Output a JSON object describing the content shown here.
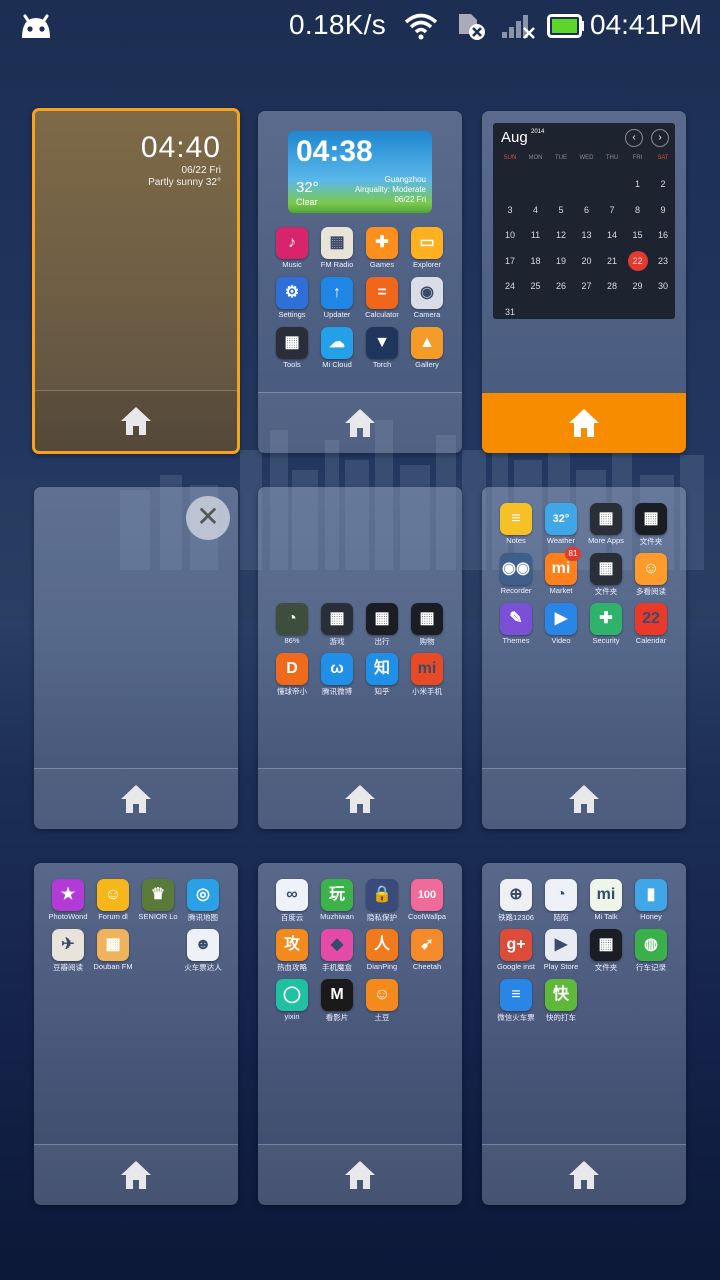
{
  "status_bar": {
    "speed": "0.18K/s",
    "time": "04:41PM",
    "icons": [
      "android-icon",
      "wifi-icon",
      "sim-off-icon",
      "signal-icon",
      "battery-icon"
    ]
  },
  "screens": [
    {
      "id": "screen-1",
      "widget": {
        "type": "clock",
        "time": "04:40",
        "date": "06/22 Fri",
        "weather": "Partly sunny  32°"
      }
    },
    {
      "id": "screen-2",
      "widget": {
        "type": "weather",
        "time": "04:38",
        "temp": "32°",
        "condition": "Clear",
        "city": "Guangzhou",
        "air": "Airquality: Moderate",
        "date": "06/22 Fri"
      },
      "apps": [
        {
          "label": "Music",
          "color": "#d8246a",
          "glyph": "♪"
        },
        {
          "label": "FM Radio",
          "color": "#e9e4d8",
          "glyph": "▦"
        },
        {
          "label": "Games",
          "color": "#ff8f1c",
          "glyph": "✚"
        },
        {
          "label": "Explorer",
          "color": "#ffb020",
          "glyph": "▭"
        },
        {
          "label": "Settings",
          "color": "#2e6fd8",
          "glyph": "⚙"
        },
        {
          "label": "Updater",
          "color": "#1f86e6",
          "glyph": "↑"
        },
        {
          "label": "Calculator",
          "color": "#f0661a",
          "glyph": "="
        },
        {
          "label": "Camera",
          "color": "#d9dde6",
          "glyph": "◉"
        },
        {
          "label": "Tools",
          "color": "#2a2e38",
          "glyph": "▦"
        },
        {
          "label": "Mi Cloud",
          "color": "#23a0e8",
          "glyph": "☁"
        },
        {
          "label": "Torch",
          "color": "#20355c",
          "glyph": "▼"
        },
        {
          "label": "Gallery",
          "color": "#f59b2a",
          "glyph": "▲"
        }
      ]
    },
    {
      "id": "screen-3",
      "widget": {
        "type": "calendar",
        "month": "Aug",
        "year": "2014",
        "weekdays": [
          "SUN",
          "MON",
          "TUE",
          "WED",
          "THU",
          "FRI",
          "SAT"
        ],
        "weeks": [
          [
            "",
            "",
            "",
            "",
            "",
            "1",
            "2"
          ],
          [
            "3",
            "4",
            "5",
            "6",
            "7",
            "8",
            "9"
          ],
          [
            "10",
            "11",
            "12",
            "13",
            "14",
            "15",
            "16"
          ],
          [
            "17",
            "18",
            "19",
            "20",
            "21",
            "22",
            "23"
          ],
          [
            "24",
            "25",
            "26",
            "27",
            "28",
            "29",
            "30"
          ],
          [
            "31",
            "",
            "",
            "",
            "",
            "",
            ""
          ]
        ],
        "today": "22"
      }
    },
    {
      "id": "screen-4",
      "apps": []
    },
    {
      "id": "screen-5",
      "apps": [
        {
          "label": "86%",
          "color": "#3d4e3c",
          "glyph": "◔"
        },
        {
          "label": "游戏",
          "color": "#2a2e38",
          "glyph": "▦"
        },
        {
          "label": "出行",
          "color": "#1a1d24",
          "glyph": "▦"
        },
        {
          "label": "购物",
          "color": "#1a1d24",
          "glyph": "▦"
        },
        {
          "label": "懂球帝小",
          "color": "#f06a1c",
          "glyph": "D"
        },
        {
          "label": "腾讯微博",
          "color": "#1f8fe8",
          "glyph": "ω"
        },
        {
          "label": "知乎",
          "color": "#1f8fe8",
          "glyph": "知"
        },
        {
          "label": "小米手机",
          "color": "#e74a25",
          "glyph": "mi"
        }
      ]
    },
    {
      "id": "screen-6",
      "apps": [
        {
          "label": "Notes",
          "color": "#f5c126",
          "glyph": "≡"
        },
        {
          "label": "Weather",
          "color": "#3fa6e8",
          "glyph": "32°"
        },
        {
          "label": "More Apps",
          "color": "#2a2e38",
          "glyph": "▦"
        },
        {
          "label": "文件夹",
          "color": "#1a1d24",
          "glyph": "▦"
        },
        {
          "label": "Recorder",
          "color": "#3e5e8c",
          "glyph": "◉◉"
        },
        {
          "label": "Market",
          "color": "#ff7f1a",
          "glyph": "mi"
        },
        {
          "label": "文件夹",
          "color": "#2a2e38",
          "glyph": "▦"
        },
        {
          "label": "多看阅读",
          "color": "#ff9b2a",
          "glyph": "☺"
        },
        {
          "label": "Themes",
          "color": "#7b4fd6",
          "glyph": "✎"
        },
        {
          "label": "Video",
          "color": "#2a86e6",
          "glyph": "▶"
        },
        {
          "label": "Security",
          "color": "#2fb36a",
          "glyph": "✚"
        },
        {
          "label": "Calendar",
          "color": "#e8392b",
          "glyph": "22"
        }
      ],
      "badge": "81"
    },
    {
      "id": "screen-7",
      "apps": [
        {
          "label": "PhotoWond",
          "color": "#b43ad8",
          "glyph": "★"
        },
        {
          "label": "Forum dl",
          "color": "#f5b71a",
          "glyph": "☺"
        },
        {
          "label": "SENIOR Lo",
          "color": "#5a7a3a",
          "glyph": "♛"
        },
        {
          "label": "腾讯地图",
          "color": "#2aa0e6",
          "glyph": "◎"
        },
        {
          "label": "豆瓣阅读",
          "color": "#e8e4dc",
          "glyph": "✈"
        },
        {
          "label": "Douban FM",
          "color": "#f0b25a",
          "glyph": "▦"
        },
        {
          "label": "",
          "color": "transparent",
          "glyph": ""
        },
        {
          "label": "火车票达人",
          "color": "#eef2f8",
          "glyph": "☻"
        }
      ]
    },
    {
      "id": "screen-8",
      "apps": [
        {
          "label": "百度云",
          "color": "#eef3fb",
          "glyph": "∞"
        },
        {
          "label": "Muzhiwan",
          "color": "#3cb34a",
          "glyph": "玩"
        },
        {
          "label": "隐私保护",
          "color": "#3a4a7a",
          "glyph": "🔒"
        },
        {
          "label": "CoolWallpa",
          "color": "#f06a9a",
          "glyph": "100"
        },
        {
          "label": "热血攻略",
          "color": "#f58a1c",
          "glyph": "攻"
        },
        {
          "label": "手机魔盒",
          "color": "#e64aa8",
          "glyph": "◆"
        },
        {
          "label": "DianPing",
          "color": "#f07a1c",
          "glyph": "人"
        },
        {
          "label": "Cheetah",
          "color": "#f58a2a",
          "glyph": "➹"
        },
        {
          "label": "yixin",
          "color": "#1fc1a2",
          "glyph": "◯"
        },
        {
          "label": "看影片",
          "color": "#1a1a1a",
          "glyph": "M"
        },
        {
          "label": "土豆",
          "color": "#f58a1c",
          "glyph": "☺"
        }
      ]
    },
    {
      "id": "screen-9",
      "apps": [
        {
          "label": "铁路12306",
          "color": "#eef0f4",
          "glyph": "⊕"
        },
        {
          "label": "陌陌",
          "color": "#eef2f8",
          "glyph": "◔"
        },
        {
          "label": "Mi Talk",
          "color": "#eef6ec",
          "glyph": "mi"
        },
        {
          "label": "Honey",
          "color": "#3fa6e8",
          "glyph": "▮"
        },
        {
          "label": "Google inst",
          "color": "#dd4b39",
          "glyph": "g+"
        },
        {
          "label": "Play Store",
          "color": "#e8ecf2",
          "glyph": "▶"
        },
        {
          "label": "文件夹",
          "color": "#1a1d24",
          "glyph": "▦"
        },
        {
          "label": "行车记录",
          "color": "#3ab04a",
          "glyph": "◍"
        },
        {
          "label": "微信火车票",
          "color": "#2a86e6",
          "glyph": "≡"
        },
        {
          "label": "快的打车",
          "color": "#5fb83a",
          "glyph": "快"
        }
      ]
    }
  ]
}
